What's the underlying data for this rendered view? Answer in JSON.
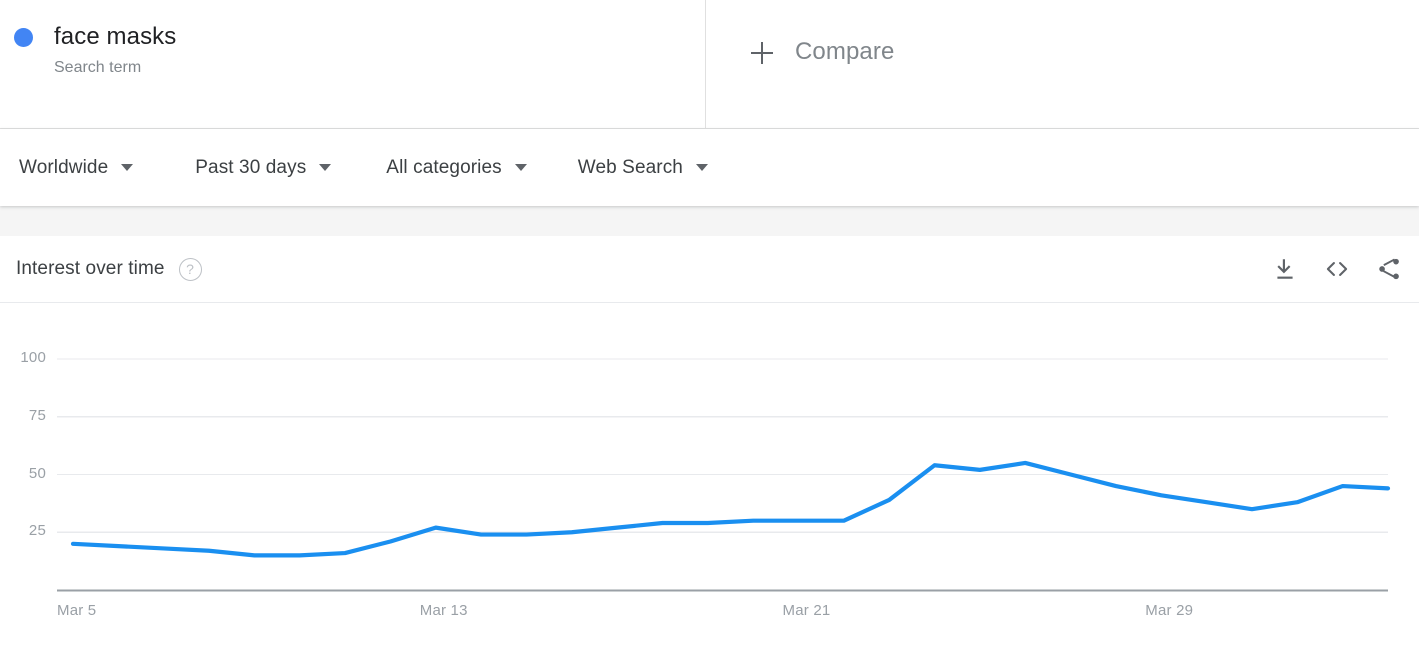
{
  "term": {
    "name": "face masks",
    "type_label": "Search term",
    "dot_color": "#4285f4"
  },
  "compare": {
    "label": "Compare",
    "icon": "plus-icon"
  },
  "filters": [
    {
      "label": "Worldwide",
      "icon": "chevron-down-icon"
    },
    {
      "label": "Past 30 days",
      "icon": "chevron-down-icon"
    },
    {
      "label": "All categories",
      "icon": "chevron-down-icon"
    },
    {
      "label": "Web Search",
      "icon": "chevron-down-icon"
    }
  ],
  "card": {
    "title": "Interest over time",
    "help_icon": "help-icon",
    "help_glyph": "?",
    "actions": [
      {
        "name": "download-icon"
      },
      {
        "name": "embed-icon"
      },
      {
        "name": "share-icon"
      }
    ]
  },
  "chart_data": {
    "type": "line",
    "title": "Interest over time",
    "xlabel": "",
    "ylabel": "",
    "ylim": [
      0,
      100
    ],
    "yticks": [
      25,
      50,
      75,
      100
    ],
    "xticks": [
      "Mar 5",
      "Mar 13",
      "Mar 21",
      "Mar 29"
    ],
    "xtick_indices": [
      0,
      8,
      16,
      24
    ],
    "grid": true,
    "legend": false,
    "line_color": "#1a8ff0",
    "series": [
      {
        "name": "face masks",
        "x": [
          "Mar 5",
          "Mar 6",
          "Mar 7",
          "Mar 8",
          "Mar 9",
          "Mar 10",
          "Mar 11",
          "Mar 12",
          "Mar 13",
          "Mar 14",
          "Mar 15",
          "Mar 16",
          "Mar 17",
          "Mar 18",
          "Mar 19",
          "Mar 20",
          "Mar 21",
          "Mar 22",
          "Mar 23",
          "Mar 24",
          "Mar 25",
          "Mar 26",
          "Mar 27",
          "Mar 28",
          "Mar 29",
          "Mar 30",
          "Mar 31",
          "Apr 1",
          "Apr 2",
          "Apr 3"
        ],
        "values": [
          20,
          19,
          18,
          17,
          15,
          15,
          16,
          21,
          27,
          24,
          24,
          25,
          27,
          29,
          29,
          30,
          30,
          30,
          39,
          54,
          52,
          55,
          50,
          45,
          41,
          38,
          35,
          38,
          45,
          44
        ]
      }
    ]
  }
}
